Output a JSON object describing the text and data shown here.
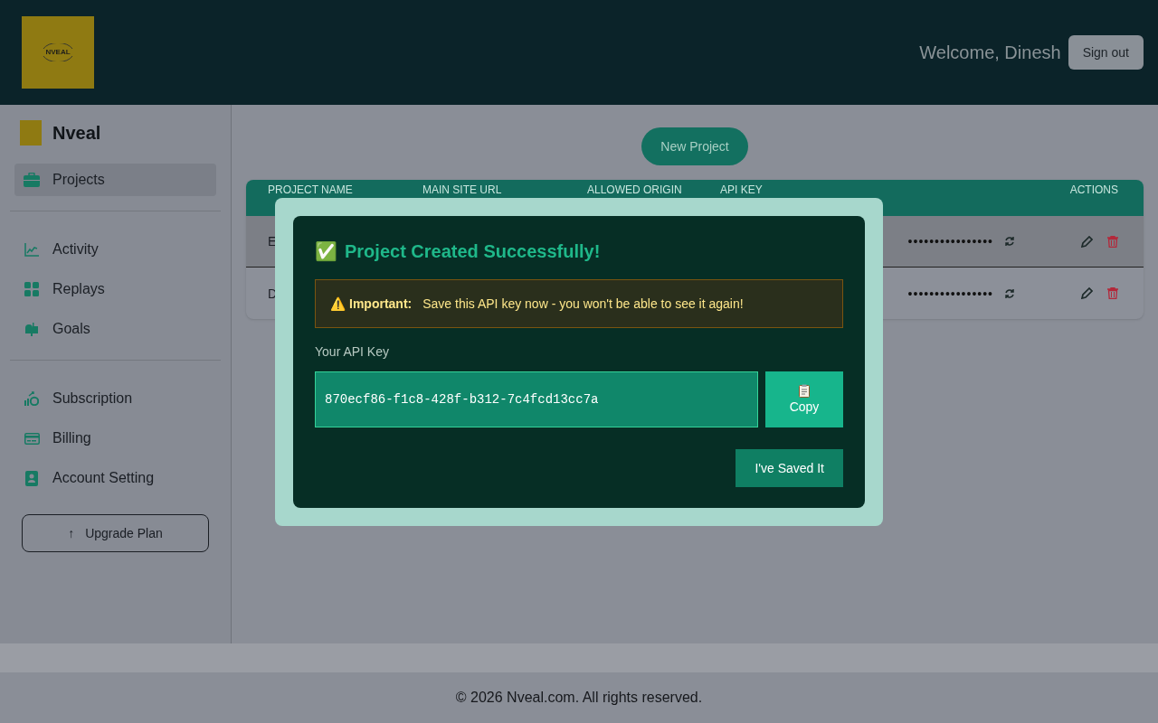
{
  "header": {
    "logo_text": "NVEAL",
    "welcome": "Welcome, Dinesh",
    "sign_out": "Sign out"
  },
  "sidebar": {
    "brand": "Nveal",
    "items": [
      {
        "label": "Projects",
        "selected": true
      },
      {
        "label": "Activity",
        "selected": false
      },
      {
        "label": "Replays",
        "selected": false
      },
      {
        "label": "Goals",
        "selected": false
      },
      {
        "label": "Subscription",
        "selected": false
      },
      {
        "label": "Billing",
        "selected": false
      },
      {
        "label": "Account Setting",
        "selected": false
      }
    ],
    "upgrade": {
      "icon": "↑",
      "label": "Upgrade Plan"
    }
  },
  "main": {
    "new_project": "New Project",
    "table": {
      "columns": [
        "PROJECT NAME",
        "MAIN SITE URL",
        "ALLOWED ORIGIN",
        "API KEY",
        "ACTIONS"
      ],
      "rows": [
        {
          "name": "E",
          "api_key": "••••••••••••••••",
          "selected": true
        },
        {
          "name": "D",
          "api_key": "••••••••••••••••",
          "selected": false
        }
      ]
    }
  },
  "modal": {
    "title_icon": "✅",
    "title": "Project Created Successfully!",
    "warning_icon": "⚠️",
    "warning_label": "Important:",
    "warning_text": "Save this API key now - you won't be able to see it again!",
    "key_label": "Your API Key",
    "key_value": "870ecf86-f1c8-428f-b312-7c4fcd13cc7a",
    "copy_label": "Copy",
    "confirm": "I've Saved It"
  },
  "footer": "© 2026 Nveal.com. All rights reserved."
}
